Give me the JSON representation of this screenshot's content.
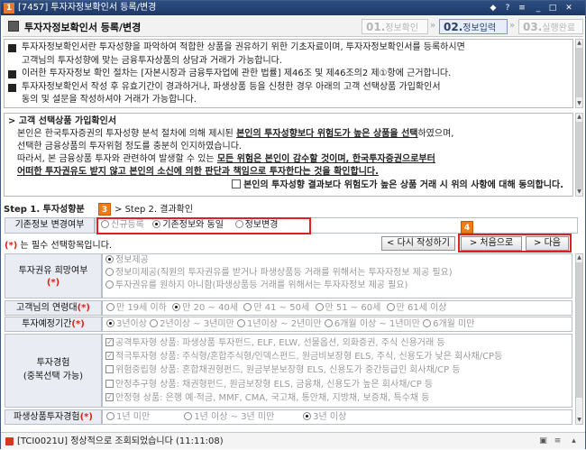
{
  "window": {
    "num": "1",
    "title": "[7457] 투자자정보확인서 등록/변경",
    "tb_icons": [
      "pin-icon",
      "help-icon",
      "menu-icon",
      "minimize-icon",
      "maximize-icon",
      "close-icon"
    ]
  },
  "header": {
    "title": "투자자정보확인서 등록/변경",
    "steps": [
      {
        "num": "01.",
        "label": "정보확인",
        "active": false
      },
      {
        "num": "02.",
        "label": "정보입력",
        "active": true
      },
      {
        "num": "03.",
        "label": "실행완료",
        "active": false
      }
    ]
  },
  "notice": [
    [
      "투자자정보확인서란 투자성향을 파악하여 적합한 상품을 권유하기 위한 기초자료이며, 투자자정보확인서를 등록하시면",
      "고객님의 투자성향에 맞는 금융투자상품의 상담과 거래가 가능합니다."
    ],
    [
      "이러한 투자자정보 확인 절차는 [자본시장과 금융투자업에 관한 법률] 제46조 및 제46조의2 제①항에 근거합니다."
    ],
    [
      "투자자정보확인서 작성 후 유효기간이 경과하거나, 파생상품 등을 신청한 경우 아래의 고객 선택상품 가입확인서",
      "동의 및 설문을 작성하셔야 거래가 가능합니다."
    ]
  ],
  "selected_product": {
    "title": "> 고객 선택상품 가입확인서",
    "p1a": "본인은 한국투자증권의 투자성향 분석 절차에 의해 제시된 ",
    "p1b": "본인의 투자성향보다 위험도가 높은 상품을 선택",
    "p1c": "하였으며,",
    "p2": "선택한 금융상품의 투자위험 정도를 충분히 인지하였습니다.",
    "p3a": "따라서, 본 금융상품 투자와 관련하여 발생할 수 있는 ",
    "p3b": "모든 위험은 본인이 감수할 것이며, 한국투자증권으로부터",
    "p4": "어떠한 투자권유도 받지 않고 본인의 소신에 의한 판단과 책임으로 투자한다는 것을 확인합니다.",
    "agree": "본인의 투자성향 결과보다 위험도가 높은 상품 거래 시 위의 사항에 대해 동의합니다."
  },
  "stepbar": {
    "step1": "Step 1. 투자성향분",
    "badge3": "3",
    "sep": ">",
    "step2": "Step 2. 결과확인"
  },
  "basic_change": {
    "label": "기존정보 변경여부",
    "options": [
      {
        "label": "신규등록",
        "sel": false,
        "dim": true
      },
      {
        "label": "기존정보와 동일",
        "sel": true,
        "dim": false
      },
      {
        "label": "정보변경",
        "sel": false,
        "dim": false
      }
    ]
  },
  "required_note": {
    "mark": "(*)",
    "text": " 는 필수 선택항목입니다."
  },
  "buttons": {
    "rewrite": "< 다시 작성하기",
    "first": "> 처음으로",
    "next": "> 다음",
    "badge4": "4"
  },
  "q_hope": {
    "label": "투자권유 희망여부",
    "req": "(*)",
    "options": [
      {
        "label": "정보제공",
        "sel": true
      },
      {
        "label": "정보미제공(직원의 투자권유를 받거나 파생상품등 거래를 위해서는 투자자정보 제공 필요)",
        "sel": false
      },
      {
        "label": "투자권유를 원하지 아니함(파생상품등 거래를 위해서는 투자자정보 제공 필요)",
        "sel": false
      }
    ]
  },
  "q_age": {
    "label": "고객님의 연령대",
    "req": "(*)",
    "options": [
      {
        "label": "만 19세 이하",
        "sel": false
      },
      {
        "label": "만 20 ~ 40세",
        "sel": true
      },
      {
        "label": "만 41 ~ 50세",
        "sel": false
      },
      {
        "label": "만 51 ~ 60세",
        "sel": false
      },
      {
        "label": "만 61세 이상",
        "sel": false
      }
    ]
  },
  "q_period": {
    "label": "투자예정기간",
    "req": "(*)",
    "options": [
      {
        "label": "3년이상",
        "sel": true
      },
      {
        "label": "2년이상 ~ 3년미만",
        "sel": false
      },
      {
        "label": "1년이상 ~ 2년미만",
        "sel": false
      },
      {
        "label": "6개월 이상 ~ 1년미만",
        "sel": false
      },
      {
        "label": "6개월 미만",
        "sel": false
      }
    ]
  },
  "q_exp": {
    "label": "투자경험",
    "sub": "(중복선택 가능)",
    "options": [
      {
        "label": "공격투자형 상품: 파생상품 투자펀드, ELF, ELW, 선물옵션, 외화증권, 주식 신용거래 등",
        "chk": true
      },
      {
        "label": "적극투자형 상품: 주식형/혼합주식형/인덱스펀드, 원금비보장형 ELS, 주식, 신용도가 낮은 회사채/CP등",
        "chk": true
      },
      {
        "label": "위험중립형 상품: 혼합채권형펀드, 원금부분보장형 ELS, 신용도가 중간등급인 회사채/CP 등",
        "chk": false
      },
      {
        "label": "안정추구형 상품: 채권형펀드, 원금보장형 ELS, 금융채, 신용도가 높은 회사채/CP 등",
        "chk": false
      },
      {
        "label": "안정형 상품: 은행 예·적금, MMF, CMA, 국고채, 통안채, 지방채, 보증채, 특수채 등",
        "chk": true
      }
    ]
  },
  "q_deriv": {
    "label": "파생상품투자경험",
    "req": "(*)",
    "options": [
      {
        "label": "1년 미만",
        "sel": false
      },
      {
        "label": "1년 이상 ~ 3년 미만",
        "sel": false
      },
      {
        "label": "3년 이상",
        "sel": true
      }
    ]
  },
  "status": {
    "text": "[TCI0021U] 정상적으로 조회되었습니다 (11:11:08)"
  }
}
